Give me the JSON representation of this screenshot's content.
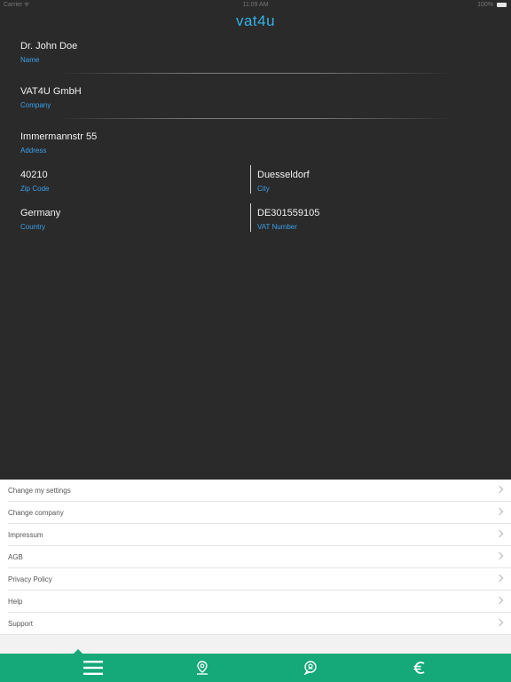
{
  "status": {
    "carrier": "Carrier",
    "time": "11:09 AM",
    "battery": "100%"
  },
  "app": {
    "logo": "vat4u"
  },
  "profile": {
    "name": {
      "value": "Dr. John Doe",
      "label": "Name"
    },
    "company": {
      "value": "VAT4U GmbH",
      "label": "Company"
    },
    "address": {
      "value": "Immermannstr 55",
      "label": "Address"
    },
    "zip": {
      "value": "40210",
      "label": "Zip Code"
    },
    "city": {
      "value": "Duesseldorf",
      "label": "City"
    },
    "country": {
      "value": "Germany",
      "label": "Country"
    },
    "vat": {
      "value": "DE301559105",
      "label": "VAT Number"
    }
  },
  "menu": {
    "items": [
      {
        "label": "Change my settings"
      },
      {
        "label": "Change company"
      },
      {
        "label": "Impressum"
      },
      {
        "label": "AGB"
      },
      {
        "label": "Privacy Policy"
      },
      {
        "label": "Help"
      },
      {
        "label": "Support"
      }
    ]
  },
  "tabbar": {
    "color": "#15a878",
    "tabs": [
      {
        "icon": "menu-icon",
        "active": true
      },
      {
        "icon": "map-pin-icon"
      },
      {
        "icon": "receipt-bubble-icon"
      },
      {
        "icon": "euro-icon"
      }
    ]
  },
  "colors": {
    "accent_label": "#3aa0ea",
    "logo": "#35b0e8",
    "background": "#2a2a2a"
  }
}
